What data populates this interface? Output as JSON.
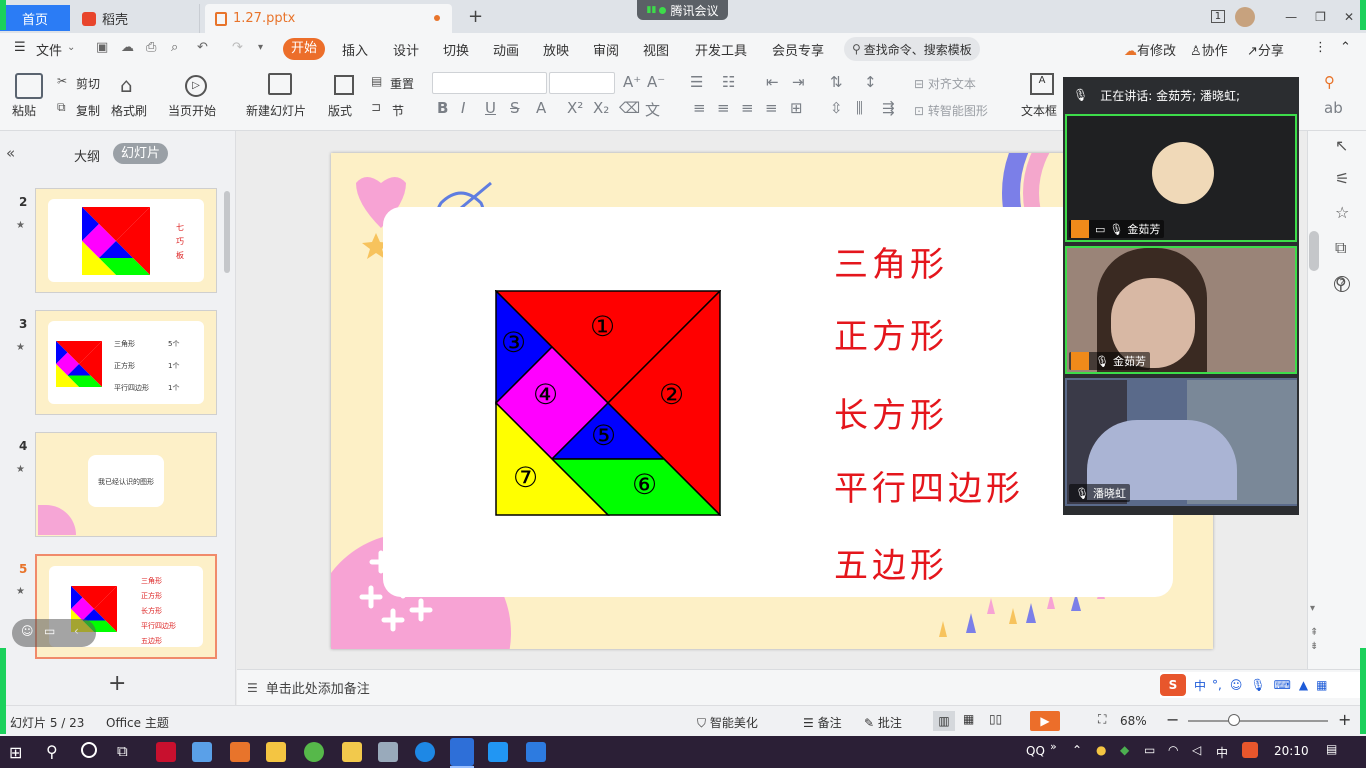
{
  "tabs": {
    "home": "首页",
    "docer": "稻壳",
    "file": "1.27.pptx",
    "add": "+"
  },
  "meeting_chip": "腾讯会议",
  "window": {
    "badge": "1",
    "minimize": "—",
    "restore": "❐",
    "close": "✕"
  },
  "menu": {
    "file": "文件",
    "items": [
      "开始",
      "插入",
      "设计",
      "切换",
      "动画",
      "放映",
      "审阅",
      "视图",
      "开发工具",
      "会员专享"
    ],
    "search": "查找命令、搜索模板",
    "right": [
      "有修改",
      "协作",
      "分享"
    ]
  },
  "ribbon": {
    "paste": "粘贴",
    "cut": "剪切",
    "copy": "复制",
    "format_painter": "格式刷",
    "from_current": "当页开始",
    "new_slide": "新建幻灯片",
    "layout": "版式",
    "section": "节",
    "reset": "重置",
    "align_text": "对齐文本",
    "convert_smartart": "转智能图形",
    "textbox": "文本框"
  },
  "panel": {
    "outline": "大纲",
    "slides": "幻灯片",
    "add": "+"
  },
  "thumbs": [
    {
      "num": "2",
      "lines": [
        "七",
        "巧",
        "板"
      ]
    },
    {
      "num": "3",
      "rows": [
        [
          "三角形",
          "5个"
        ],
        [
          "正方形",
          "1个"
        ],
        [
          "平行四边形",
          "1个"
        ]
      ]
    },
    {
      "num": "4",
      "title": "我已经认识的图形"
    },
    {
      "num": "5",
      "lines": [
        "三角形",
        "正方形",
        "长方形",
        "平行四边形",
        "五边形"
      ]
    }
  ],
  "slide": {
    "pieces": [
      "①",
      "②",
      "③",
      "④",
      "⑤",
      "⑥",
      "⑦"
    ],
    "labels": [
      "三角形",
      "正方形",
      "长方形",
      "平行四边形",
      "五边形"
    ]
  },
  "meeting": {
    "speaking": "正在讲话: 金茹芳; 潘晓虹;",
    "tiles": [
      {
        "name": "金茹芳",
        "active": true
      },
      {
        "name": "金茹芳",
        "active": true
      },
      {
        "name": "潘晓虹",
        "active": false
      }
    ]
  },
  "notes": "单击此处添加备注",
  "status": {
    "slide_count": "幻灯片 5 / 23",
    "theme": "Office 主题",
    "beautify": "智能美化",
    "notes_btn": "备注",
    "comment": "批注",
    "zoom": "68%"
  },
  "ime": {
    "lang": "中",
    "punct": "°,"
  },
  "taskbar": {
    "qq": "QQ",
    "time": "20:10",
    "lang": "中"
  },
  "colors": {
    "accent": "#ec6e2a",
    "red": "#ff0000",
    "blue": "#0000ff",
    "magenta": "#ff00ff",
    "green": "#00ff00",
    "yellow": "#ffff00",
    "label_red": "#e4161c"
  }
}
